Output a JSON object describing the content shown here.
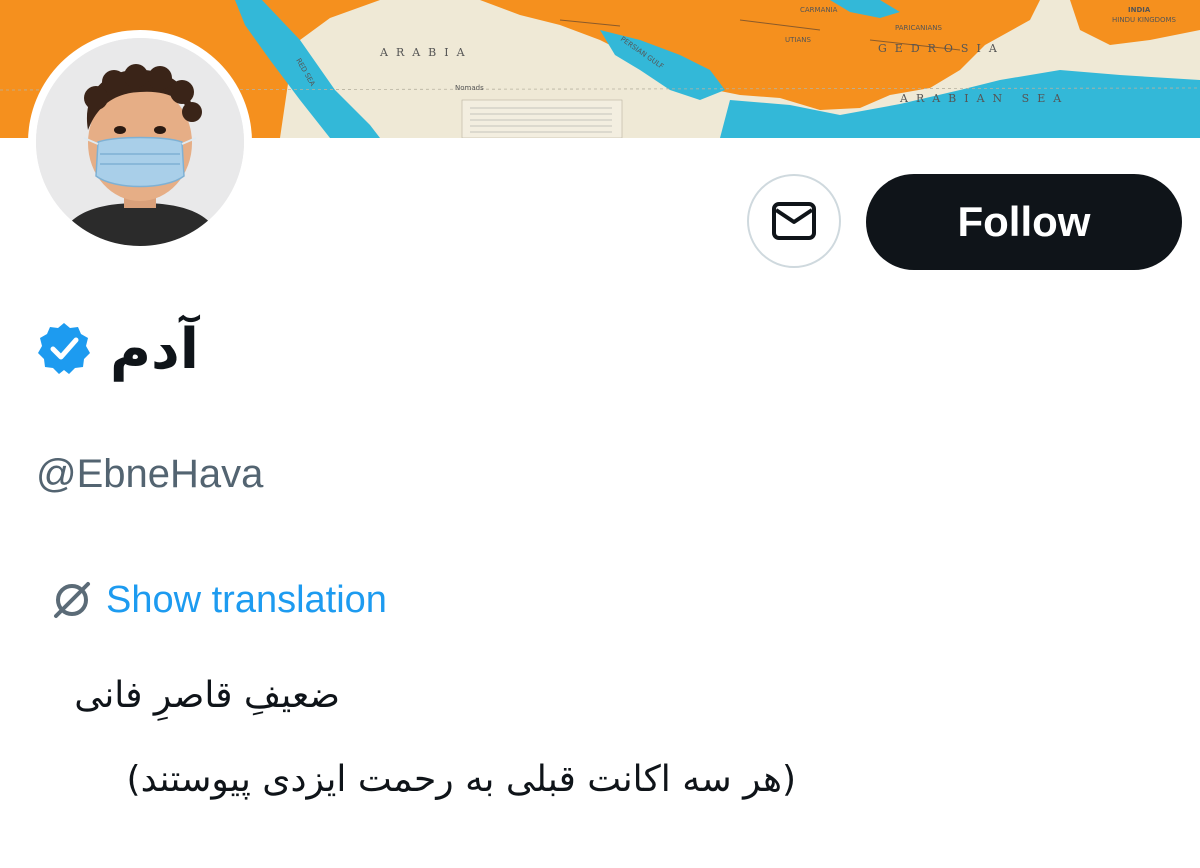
{
  "banner": {
    "map_labels": {
      "arabia": "ARABIA",
      "gedrosia": "GEDROSIA",
      "india": "INDIA",
      "hindu_kingdoms": "HINDU KINGDOMS",
      "arabian_sea": "ARABIAN SEA",
      "red_sea": "RED SEA",
      "persian_gulf": "PERSIAN GULF",
      "carmania": "CARMANIA",
      "paricanians": "PARICANIANS",
      "utians": "UTIANS",
      "nomads": "Nomads"
    }
  },
  "profile": {
    "display_name": "آدم",
    "handle": "@EbneHava",
    "verified": true
  },
  "actions": {
    "follow_label": "Follow",
    "message_icon": "envelope-icon"
  },
  "translation": {
    "label": "Show translation",
    "icon": "translate-icon"
  },
  "bio": {
    "line1": "ضعیفِ قاصرِ فانی",
    "line2": "(هر سه اکانت قبلی به رحمت ایزدی پیوستند)"
  },
  "colors": {
    "follow_bg": "#0f1419",
    "link": "#1d9bf0",
    "verified": "#1d9bf0",
    "secondary_text": "#536471",
    "map_land": "#f5901e",
    "map_water": "#33b8d8",
    "map_paper": "#efe9d6"
  }
}
